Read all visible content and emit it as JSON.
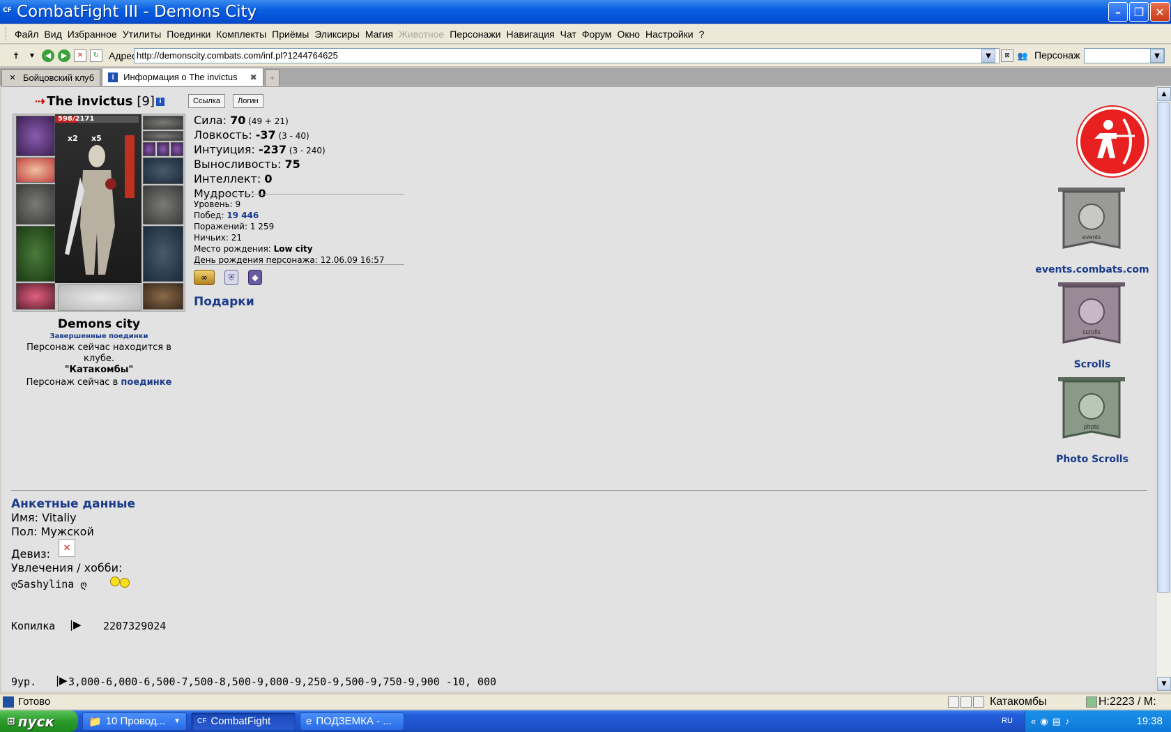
{
  "window": {
    "icon_text": "CF",
    "title": "CombatFight III - Demons City",
    "minimize": "–",
    "maximize": "❐",
    "close": "✕"
  },
  "menu": [
    "Файл",
    "Вид",
    "Избранное",
    "Утилиты",
    "Поединки",
    "Комплекты",
    "Приёмы",
    "Эликсиры",
    "Магия",
    "Животное",
    "Персонажи",
    "Навигация",
    "Чат",
    "Форум",
    "Окно",
    "Настройки",
    "?"
  ],
  "menu_disabled_index": 9,
  "address": {
    "label": "Адрес",
    "url": "http://demonscity.combats.com/inf.pl?1244764625",
    "persona_label": "Персонаж"
  },
  "tabs": [
    {
      "label": "Бойцовский клуб",
      "icon": "crossed-swords-icon"
    },
    {
      "label": "Информация о The invictus",
      "icon": "info-icon"
    }
  ],
  "character": {
    "name": "The invictus",
    "level": "[9]",
    "link_btn": "Ссылка",
    "login_btn": "Логин",
    "hp": "598/2171",
    "hp_fraction": 0.275,
    "buff1": "x2",
    "buff2": "x5",
    "city": "Demons city",
    "done_fights": "Завершенные поединки",
    "loc_line1": "Персонаж сейчас находится в клубе.",
    "loc_place": "\"Катакомбы\"",
    "loc_fight_prefix": "Персонаж сейчас в ",
    "loc_fight_link": "поединке"
  },
  "stats": [
    {
      "label": "Сила: ",
      "value": "70",
      "sub": " (49 + 21)"
    },
    {
      "label": "Ловкость: ",
      "value": "-37",
      "sub": " (3 - 40)"
    },
    {
      "label": "Интуиция: ",
      "value": "-237",
      "sub": " (3 - 240)"
    },
    {
      "label": "Выносливость: ",
      "value": "75",
      "sub": ""
    },
    {
      "label": "Интеллект: ",
      "value": "0",
      "sub": ""
    },
    {
      "label": "Мудрость: ",
      "value": "0",
      "sub": ""
    }
  ],
  "info": {
    "level_label": "Уровень: ",
    "level": "9",
    "wins_label": "Побед: ",
    "wins": "19 446",
    "losses_label": "Поражений: ",
    "losses": "1 259",
    "draws_label": "Ничьих: ",
    "draws": "21",
    "birthplace_label": "Место рождения: ",
    "birthplace": "Low city",
    "birthday_label": "День рождения персонажа: ",
    "birthday": "12.06.09 16:57"
  },
  "gifts_label": "Подарки",
  "banners": [
    {
      "label": "events.combats.com",
      "banner_text": "events"
    },
    {
      "label": "Scrolls",
      "banner_text": "scrolls"
    },
    {
      "label": "Photo Scrolls",
      "banner_text": "photo"
    }
  ],
  "profile": {
    "title": "Анкетные данные",
    "name": "Имя: Vitaliy",
    "gender": "Пол: Мужской",
    "motto": "Девиз:",
    "hobby": "Увлечения / хобби:",
    "hobby_text": "ღSashylina ღ",
    "piggy_label": "Копилка",
    "piggy_value": "2207329024",
    "lvl_label": "9ур.",
    "lvl_line": "3,000-6,000-6,500-7,500-8,500-9,000-9,250-9,500-9,750-9,900 -10, 000"
  },
  "status": {
    "text": "Готово",
    "location": "Катакомбы",
    "hm": "H:2223 / M:"
  },
  "taskbar": {
    "start": "пуск",
    "items": [
      "10 Провод...",
      "CombatFight",
      "ПОДЗЕМКА - ..."
    ],
    "lang": "RU",
    "clock": "19:38"
  }
}
